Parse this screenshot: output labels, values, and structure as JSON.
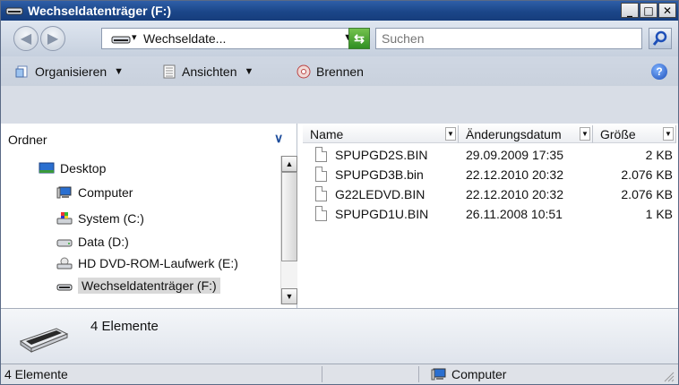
{
  "window": {
    "title": "Wechseldatenträger (F:)",
    "controls": {
      "minimize": "_",
      "maximize": "□",
      "close": "✕"
    }
  },
  "address_bar": {
    "path": "Wechseldate...",
    "search_placeholder": "Suchen"
  },
  "toolbar": {
    "organize": "Organisieren",
    "views": "Ansichten",
    "burn": "Brennen"
  },
  "folder_pane": {
    "header": "Ordner",
    "items": [
      {
        "label": "Desktop",
        "icon": "desktop-icon"
      },
      {
        "label": "Computer",
        "icon": "computer-icon"
      },
      {
        "label": "System (C:)",
        "icon": "system-drive-icon"
      },
      {
        "label": "Data (D:)",
        "icon": "hard-drive-icon"
      },
      {
        "label": "HD DVD-ROM-Laufwerk (E:)",
        "icon": "dvd-drive-icon"
      },
      {
        "label": "Wechseldatenträger (F:)",
        "icon": "removable-drive-icon",
        "selected": true
      }
    ]
  },
  "file_list": {
    "columns": [
      "Name",
      "Änderungsdatum",
      "Größe"
    ],
    "rows": [
      {
        "name": "SPUPGD2S.BIN",
        "modified": "29.09.2009 17:35",
        "size": "2 KB"
      },
      {
        "name": "SPUPGD3B.bin",
        "modified": "22.12.2010 20:32",
        "size": "2.076 KB"
      },
      {
        "name": "G22LEDVD.BIN",
        "modified": "22.12.2010 20:32",
        "size": "2.076 KB"
      },
      {
        "name": "SPUPGD1U.BIN",
        "modified": "26.11.2008 10:51",
        "size": "1 KB"
      }
    ]
  },
  "details_pane": {
    "count": "4 Elemente"
  },
  "status_bar": {
    "items": "4 Elemente",
    "location": "Computer"
  }
}
